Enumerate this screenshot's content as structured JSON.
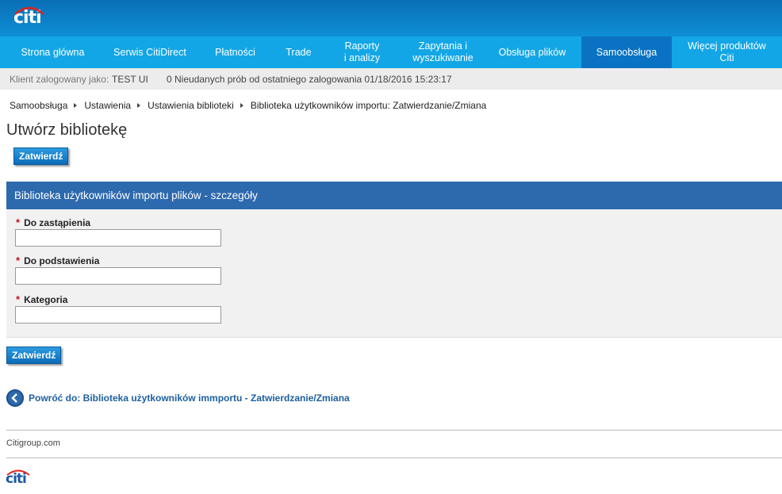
{
  "brand": {
    "logo_text": "citi",
    "footer_logo_text": "citi",
    "primary_color": "#0a6fb5",
    "nav_color": "#13a6e6",
    "active_nav_color": "#0a72c3",
    "section_color": "#2d69ad"
  },
  "nav": {
    "items": [
      {
        "label": "Strona główna"
      },
      {
        "label": "Serwis CitiDirect"
      },
      {
        "label": "Płatności"
      },
      {
        "label": "Trade"
      },
      {
        "label": "Raporty i analizy"
      },
      {
        "label": "Zapytania i wyszukiwanie"
      },
      {
        "label": "Obsługa plików"
      },
      {
        "label": "Samoobsługa"
      },
      {
        "label": "Więcej produktów Citi"
      }
    ]
  },
  "info": {
    "client_label": "Klient zalogowany jako:",
    "client_value": "TEST UI",
    "failed_logins": "0 Nieudanych prób od ostatniego zalogowania 01/18/2016 15:23:17"
  },
  "breadcrumb": [
    "Samoobsługa",
    "Ustawienia",
    "Ustawienia biblioteki",
    "Biblioteka użytkowników importu: Zatwierdzanie/Zmiana"
  ],
  "page": {
    "title": "Utwórz bibliotekę",
    "submit_label": "Zatwierdź"
  },
  "section": {
    "title": "Biblioteka użytkowników importu plików - szczegóły",
    "fields": [
      {
        "label": "Do zastąpienia",
        "value": ""
      },
      {
        "label": "Do podstawienia",
        "value": ""
      },
      {
        "label": "Kategoria",
        "value": ""
      }
    ]
  },
  "back_link": {
    "text": "Powróć do: Biblioteka użytkowników immportu - Zatwierdzanie/Zmiana",
    "icon": "back-arrow-icon"
  },
  "footer": {
    "link": "Citigroup.com"
  }
}
